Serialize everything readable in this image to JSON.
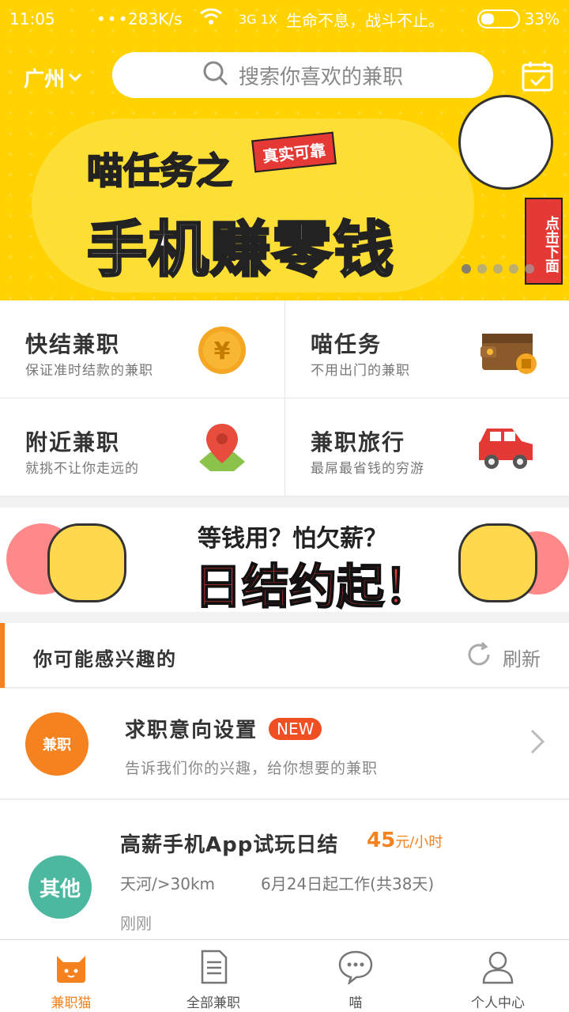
{
  "status_bar": {
    "time": "11:05",
    "dots": "•••",
    "speed": "283K/s",
    "network": "3G 1X",
    "slogan": "生命不息，战斗不止。",
    "battery": "33%"
  },
  "header": {
    "city": "广州",
    "search_placeholder": "搜索你喜欢的兼职"
  },
  "banner": {
    "small_title": "喵任务之",
    "tag": "真实可靠",
    "big_title": "手机赚零钱",
    "arrow_label": "点击下面",
    "pager_count": 5,
    "pager_active": 1
  },
  "categories": [
    {
      "title": "快结兼职",
      "subtitle": "保证准时结款的兼职",
      "icon": "coin-icon"
    },
    {
      "title": "喵任务",
      "subtitle": "不用出门的兼职",
      "icon": "wallet-icon"
    },
    {
      "title": "附近兼职",
      "subtitle": "就挑不让你走远的",
      "icon": "map-pin-icon"
    },
    {
      "title": "兼职旅行",
      "subtitle": "最屌最省钱的穷游",
      "icon": "car-icon"
    }
  ],
  "promo": {
    "question": "等钱用？怕欠薪？",
    "headline": "日结约起！"
  },
  "interest": {
    "title": "你可能感兴趣的",
    "refresh_label": "刷新"
  },
  "preference": {
    "title": "求职意向设置",
    "badge": "NEW",
    "subtitle": "告诉我们你的兴趣，给你想要的兼职",
    "logo_text": "兼职"
  },
  "job": {
    "category": "其他",
    "title": "高薪手机App试玩日结",
    "salary_value": "45",
    "salary_unit": "元/小时",
    "location": "天河/>30km",
    "start": "6月24日起工作(共38天)",
    "posted": "刚刚"
  },
  "tabs": [
    {
      "label": "兼职猫",
      "icon": "cat-icon",
      "active": true
    },
    {
      "label": "全部兼职",
      "icon": "document-icon",
      "active": false
    },
    {
      "label": "喵",
      "icon": "chat-bubble-icon",
      "active": false
    },
    {
      "label": "个人中心",
      "icon": "user-icon",
      "active": false
    }
  ],
  "colors": {
    "brand_yellow": "#ffd200",
    "accent_orange": "#f5821f",
    "badge_red": "#f04e23",
    "category_teal": "#4cb8a0"
  }
}
